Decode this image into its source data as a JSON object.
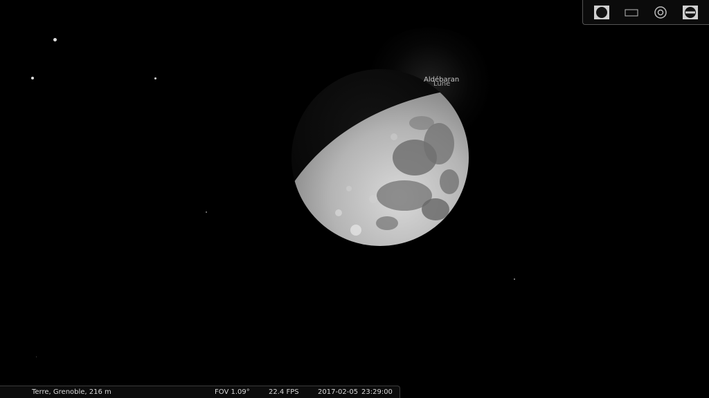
{
  "sky": {
    "labels": {
      "aldebaran": "Aldébaran",
      "moon": "Lune"
    }
  },
  "toolbar": {
    "buttons": [
      {
        "name": "night-mode-icon"
      },
      {
        "name": "fullscreen-icon"
      },
      {
        "name": "target-icon"
      },
      {
        "name": "exit-icon"
      }
    ]
  },
  "statusbar": {
    "location": "Terre, Grenoble, 216 m",
    "fov": "FOV 1.09°",
    "fps": "22.4 FPS",
    "date": "2017-02-05",
    "time": "23:29:00"
  }
}
